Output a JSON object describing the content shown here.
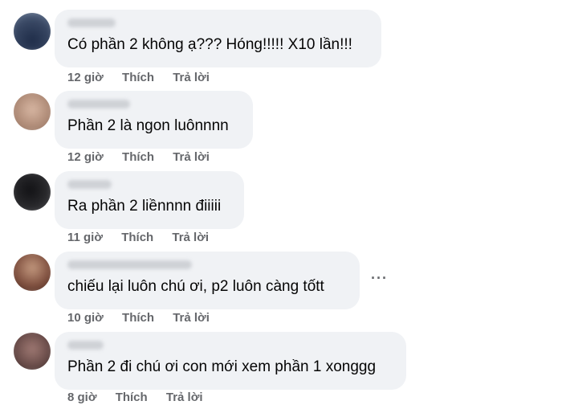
{
  "comments": [
    {
      "text": "Có phần 2 không ạ??? Hóng!!!!! X10 lần!!!",
      "time": "12 giờ",
      "like_label": "Thích",
      "reply_label": "Trả lời",
      "avatar_color": "#3b4a66"
    },
    {
      "text": "Phần 2 là ngon luônnnn",
      "time": "12 giờ",
      "like_label": "Thích",
      "reply_label": "Trả lời",
      "avatar_color": "#b08c78"
    },
    {
      "text": "Ra phần 2 liềnnnn điiiii",
      "time": "11 giờ",
      "like_label": "Thích",
      "reply_label": "Trả lời",
      "avatar_color": "#2b2b2e"
    },
    {
      "text": "chiếu lại luôn chú ơi, p2 luôn càng tốtt",
      "time": "10 giờ",
      "like_label": "Thích",
      "reply_label": "Trả lời",
      "avatar_color": "#7a4a3a",
      "more_label": "···"
    },
    {
      "text": "Phần 2 đi chú ơi con mới xem phần 1 xonggg",
      "time": "8 giờ",
      "like_label": "Thích",
      "reply_label": "Trả lời",
      "avatar_color": "#6b4d4a"
    }
  ]
}
